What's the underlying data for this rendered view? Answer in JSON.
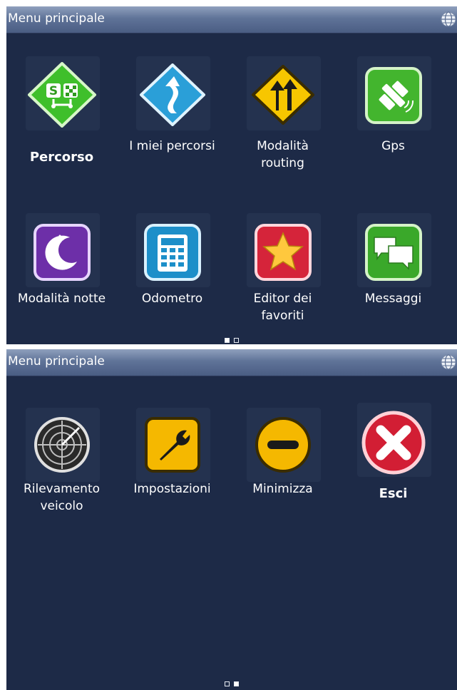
{
  "screen1": {
    "title": "Menu principale",
    "items": [
      {
        "label": "Percorso",
        "icon": "route-icon"
      },
      {
        "label": "I miei percorsi",
        "icon": "my-routes-icon"
      },
      {
        "label": "Modalità routing",
        "icon": "routing-mode-icon"
      },
      {
        "label": "Gps",
        "icon": "gps-satellite-icon"
      },
      {
        "label": "Modalità notte",
        "icon": "night-mode-icon"
      },
      {
        "label": "Odometro",
        "icon": "calculator-icon"
      },
      {
        "label": "Editor dei favoriti",
        "icon": "star-icon"
      },
      {
        "label": "Messaggi",
        "icon": "messages-icon"
      }
    ],
    "page_indicator": {
      "current": 1,
      "total": 2
    }
  },
  "screen2": {
    "title": "Menu principale",
    "items": [
      {
        "label": "Rilevamento veicolo",
        "icon": "radar-icon"
      },
      {
        "label": "Impostazioni",
        "icon": "wrench-icon"
      },
      {
        "label": "Minimizza",
        "icon": "minus-icon"
      },
      {
        "label": "Esci",
        "icon": "close-icon"
      }
    ],
    "page_indicator": {
      "current": 2,
      "total": 2
    }
  },
  "colors": {
    "background": "#1d2a47",
    "titlebar": "#5f7398",
    "text": "#ffffff"
  }
}
